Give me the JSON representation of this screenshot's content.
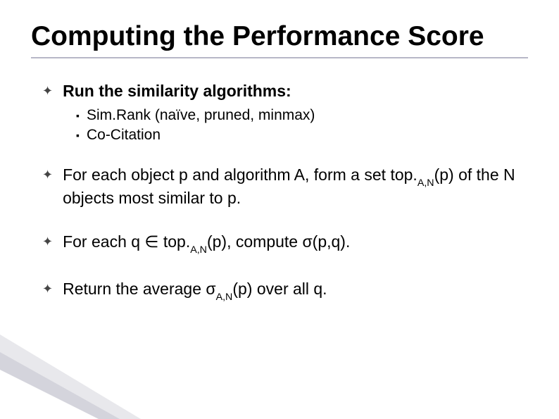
{
  "title": "Computing the Performance Score",
  "bullets": [
    {
      "text": "Run the similarity algorithms:",
      "bold": true,
      "sub": [
        "Sim.Rank (naïve, pruned, minmax)",
        "Co-Citation"
      ]
    },
    {
      "segments": [
        "For each object p and algorithm A, form a set top.",
        "A,N",
        "(p) of the N objects most similar to p."
      ]
    },
    {
      "segments": [
        "For each q ∈ top.",
        "A,N",
        "(p), compute σ(p,q)."
      ]
    },
    {
      "segments": [
        "Return the average σ",
        "A,N",
        "(p) over all q."
      ]
    }
  ]
}
